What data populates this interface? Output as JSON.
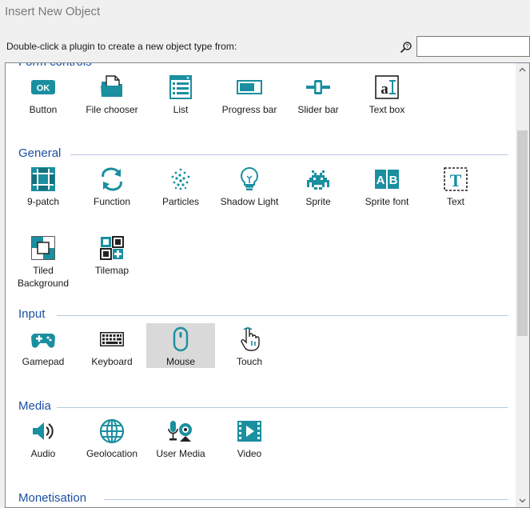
{
  "dialog": {
    "title": "Insert New Object"
  },
  "instruction": "Double-click a plugin to create a new object type from:",
  "search": {
    "value": "",
    "placeholder": ""
  },
  "categories": [
    {
      "name": "Form controls",
      "items": [
        {
          "label": "Button",
          "icon": "button-icon"
        },
        {
          "label": "File chooser",
          "icon": "file-chooser-icon"
        },
        {
          "label": "List",
          "icon": "list-icon"
        },
        {
          "label": "Progress bar",
          "icon": "progress-bar-icon"
        },
        {
          "label": "Slider bar",
          "icon": "slider-bar-icon"
        },
        {
          "label": "Text box",
          "icon": "text-box-icon"
        }
      ]
    },
    {
      "name": "General",
      "items": [
        {
          "label": "9-patch",
          "icon": "nine-patch-icon"
        },
        {
          "label": "Function",
          "icon": "function-icon"
        },
        {
          "label": "Particles",
          "icon": "particles-icon"
        },
        {
          "label": "Shadow Light",
          "icon": "shadow-light-icon"
        },
        {
          "label": "Sprite",
          "icon": "sprite-icon"
        },
        {
          "label": "Sprite font",
          "icon": "sprite-font-icon"
        },
        {
          "label": "Text",
          "icon": "text-icon"
        },
        {
          "label": "Tiled Background",
          "icon": "tiled-background-icon"
        },
        {
          "label": "Tilemap",
          "icon": "tilemap-icon"
        }
      ]
    },
    {
      "name": "Input",
      "items": [
        {
          "label": "Gamepad",
          "icon": "gamepad-icon"
        },
        {
          "label": "Keyboard",
          "icon": "keyboard-icon"
        },
        {
          "label": "Mouse",
          "icon": "mouse-icon",
          "selected": true
        },
        {
          "label": "Touch",
          "icon": "touch-icon"
        }
      ]
    },
    {
      "name": "Media",
      "items": [
        {
          "label": "Audio",
          "icon": "audio-icon"
        },
        {
          "label": "Geolocation",
          "icon": "geolocation-icon"
        },
        {
          "label": "User Media",
          "icon": "user-media-icon"
        },
        {
          "label": "Video",
          "icon": "video-icon"
        }
      ]
    },
    {
      "name": "Monetisation",
      "items": []
    }
  ],
  "colors": {
    "accent": "#1a8fa0",
    "header": "#1c4fa3",
    "selected_bg": "#d9d9d9"
  }
}
